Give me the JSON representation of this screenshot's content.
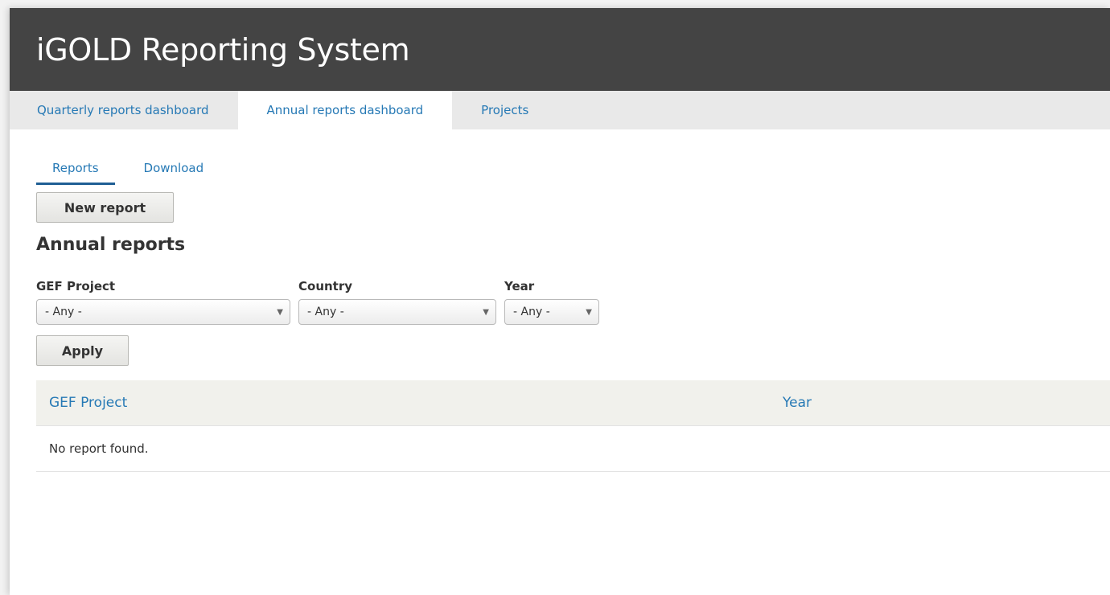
{
  "header": {
    "title": "iGOLD Reporting System"
  },
  "primary_tabs": [
    {
      "label": "Quarterly reports dashboard",
      "active": false
    },
    {
      "label": "Annual reports dashboard",
      "active": true
    },
    {
      "label": "Projects",
      "active": false
    }
  ],
  "secondary_tabs": [
    {
      "label": "Reports",
      "active": true
    },
    {
      "label": "Download",
      "active": false
    }
  ],
  "actions": {
    "new_report_label": "New report"
  },
  "section": {
    "title": "Annual reports"
  },
  "filters": {
    "gef_project": {
      "label": "GEF Project",
      "value": "- Any -"
    },
    "country": {
      "label": "Country",
      "value": "- Any -"
    },
    "year": {
      "label": "Year",
      "value": "- Any -"
    },
    "apply_label": "Apply"
  },
  "table": {
    "columns": [
      "GEF Project",
      "Year"
    ],
    "empty_message": "No report found."
  },
  "colors": {
    "header_bg": "#444444",
    "link": "#2679b5",
    "tab_bar_bg": "#e9e9e9",
    "table_header_bg": "#f1f1ec"
  },
  "icons": {
    "select_caret": "caret-down-icon"
  }
}
